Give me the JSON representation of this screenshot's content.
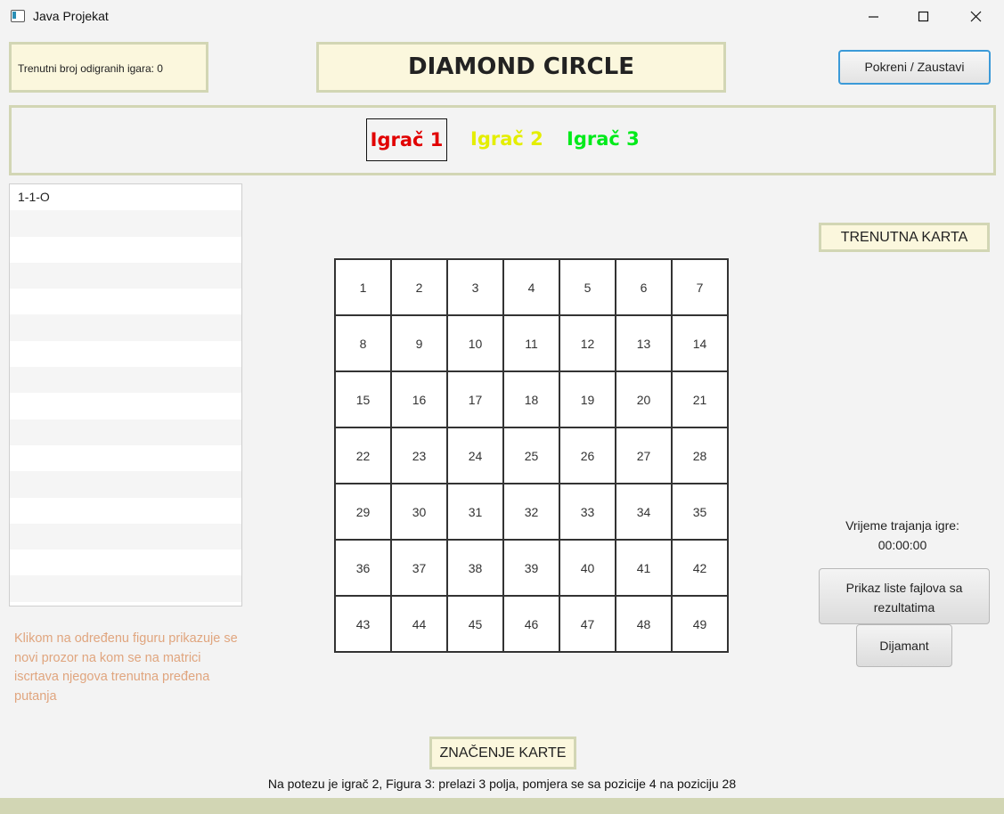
{
  "window": {
    "title": "Java Projekat",
    "icon": "app-window-icon"
  },
  "header": {
    "games_played_label": "Trenutni broj odigranih igara: 0",
    "title": "DIAMOND CIRCLE",
    "start_stop_button": "Pokreni / Zaustavi"
  },
  "players": [
    {
      "label": "Igrač 1",
      "color": "#e10000",
      "active": true
    },
    {
      "label": "Igrač 2",
      "color": "#e4ee00",
      "active": false
    },
    {
      "label": "Igrač 3",
      "color": "#00ea1a",
      "active": false
    }
  ],
  "figure_list": {
    "items": [
      "1-1-O"
    ]
  },
  "hint_text": "Klikom na određenu figuru prikazuje se novi prozor na kom se na matrici iscrtava njegova trenutna pređena putanja",
  "board": {
    "size": 7,
    "cells": [
      "1",
      "2",
      "3",
      "4",
      "5",
      "6",
      "7",
      "8",
      "9",
      "10",
      "11",
      "12",
      "13",
      "14",
      "15",
      "16",
      "17",
      "18",
      "19",
      "20",
      "21",
      "22",
      "23",
      "24",
      "25",
      "26",
      "27",
      "28",
      "29",
      "30",
      "31",
      "32",
      "33",
      "34",
      "35",
      "36",
      "37",
      "38",
      "39",
      "40",
      "41",
      "42",
      "43",
      "44",
      "45",
      "46",
      "47",
      "48",
      "49"
    ]
  },
  "right_panel": {
    "current_card_label": "TRENUTNA KARTA",
    "duration_label": "Vrijeme trajanja igre:",
    "duration_value": "00:00:00",
    "results_button": "Prikaz liste fajlova sa rezultatima",
    "diamond_button": "Dijamant"
  },
  "footer": {
    "card_meaning_label": "ZNAČENJE KARTE",
    "turn_description": "Na potezu je igrač 2, Figura 3: prelazi 3 polja, pomjera se sa pozicije 4 na poziciju 28"
  },
  "colors": {
    "panel_bg": "#fbf7dd",
    "panel_border": "#d2d6b4",
    "hint": "#e0a57e",
    "accent": "#3b9ad8"
  }
}
